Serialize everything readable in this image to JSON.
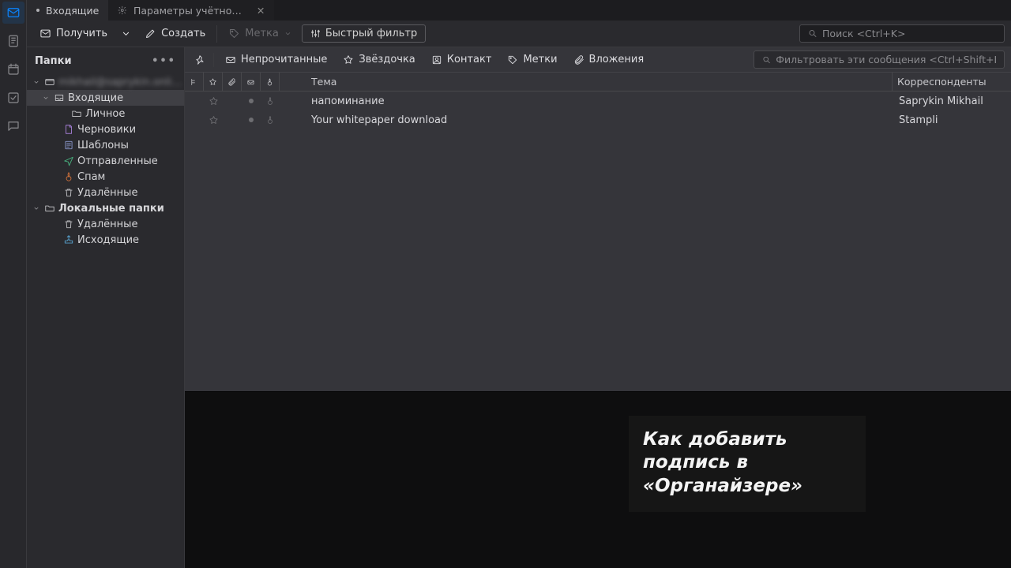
{
  "tabs": [
    {
      "label": "Входящие",
      "active": true
    },
    {
      "label": "Параметры учётной запис",
      "active": false
    }
  ],
  "toolbar": {
    "receive": "Получить",
    "compose": "Создать",
    "tag": "Метка",
    "quick_filter": "Быстрый фильтр"
  },
  "search": {
    "placeholder": "Поиск <Ctrl+K>"
  },
  "folders": {
    "header": "Папки",
    "account": "mikhail@saprykin.online",
    "items": {
      "inbox": "Входящие",
      "personal": "Личное",
      "drafts": "Черновики",
      "templates": "Шаблоны",
      "sent": "Отправленные",
      "spam": "Спам",
      "trash": "Удалённые",
      "local": "Локальные папки",
      "local_trash": "Удалённые",
      "outbox": "Исходящие"
    }
  },
  "qf": {
    "unread": "Непрочитанные",
    "starred": "Звёздочка",
    "contact": "Контакт",
    "tags": "Метки",
    "attachments": "Вложения",
    "filter_placeholder": "Фильтровать эти сообщения <Ctrl+Shift+K>"
  },
  "columns": {
    "subject": "Тема",
    "correspondents": "Корреспонденты"
  },
  "messages": [
    {
      "subject": "напоминание",
      "from": "Saprykin Mikhail"
    },
    {
      "subject": "Your whitepaper download",
      "from": "Stampli"
    }
  ],
  "preview": {
    "headline": "Как добавить подпись в «Органайзере»"
  }
}
